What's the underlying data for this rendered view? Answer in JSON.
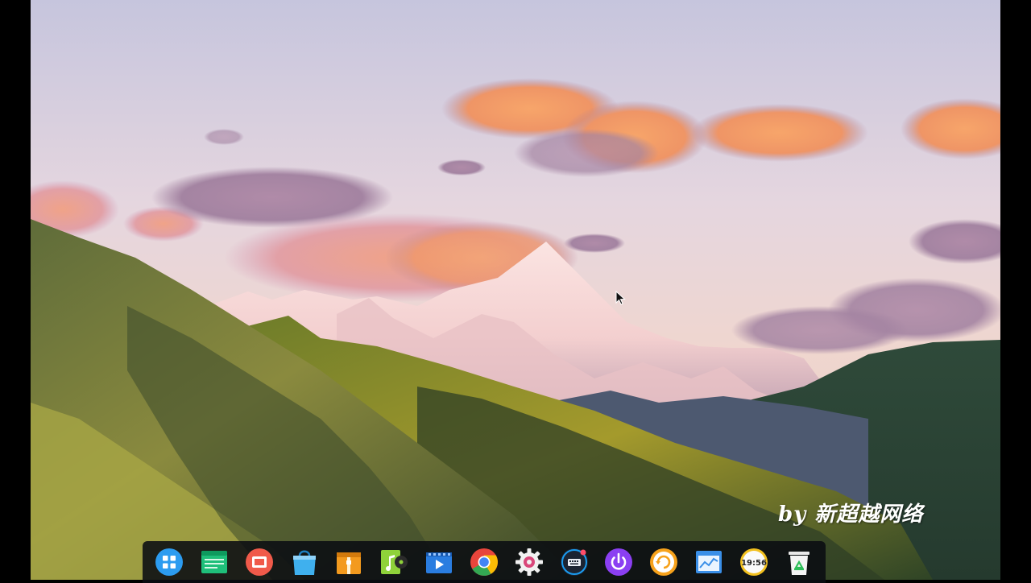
{
  "desktop": {
    "watermark_text": "by 新超越网络",
    "wallpaper": "mountain-sunset-landscape"
  },
  "dock": {
    "items": [
      {
        "name": "launcher",
        "icon": "launcher-grid-icon",
        "color": "#2c9cf0"
      },
      {
        "name": "file-manager",
        "icon": "folder-window-icon",
        "color": "#1fbf7a"
      },
      {
        "name": "screen-recorder",
        "icon": "record-window-icon",
        "color": "#f05a4a"
      },
      {
        "name": "app-store",
        "icon": "store-bag-icon",
        "color": "#3fb0ee"
      },
      {
        "name": "archive-manager",
        "icon": "archive-box-icon",
        "color": "#f39a1e"
      },
      {
        "name": "music-player",
        "icon": "music-note-icon",
        "color": "#8fd23a"
      },
      {
        "name": "video-player",
        "icon": "film-strip-icon",
        "color": "#2a7de0"
      },
      {
        "name": "chrome-browser",
        "icon": "chrome-icon",
        "color": "#e8453c"
      },
      {
        "name": "settings",
        "icon": "gear-icon",
        "color": "#d9477a"
      },
      {
        "name": "keyboard-settings",
        "icon": "keyboard-icon",
        "color": "#1a9cf0"
      },
      {
        "name": "shutdown",
        "icon": "power-icon",
        "color": "#8b3ff2"
      },
      {
        "name": "system-update",
        "icon": "refresh-circle-icon",
        "color": "#f7a21b"
      },
      {
        "name": "system-monitor",
        "icon": "monitor-chart-icon",
        "color": "#3a8fe8"
      },
      {
        "name": "clock",
        "icon": "clock-icon",
        "color": "#f2c01e",
        "label": "19:56"
      },
      {
        "name": "trash",
        "icon": "trash-icon",
        "color": "#2fbf5a"
      }
    ]
  }
}
